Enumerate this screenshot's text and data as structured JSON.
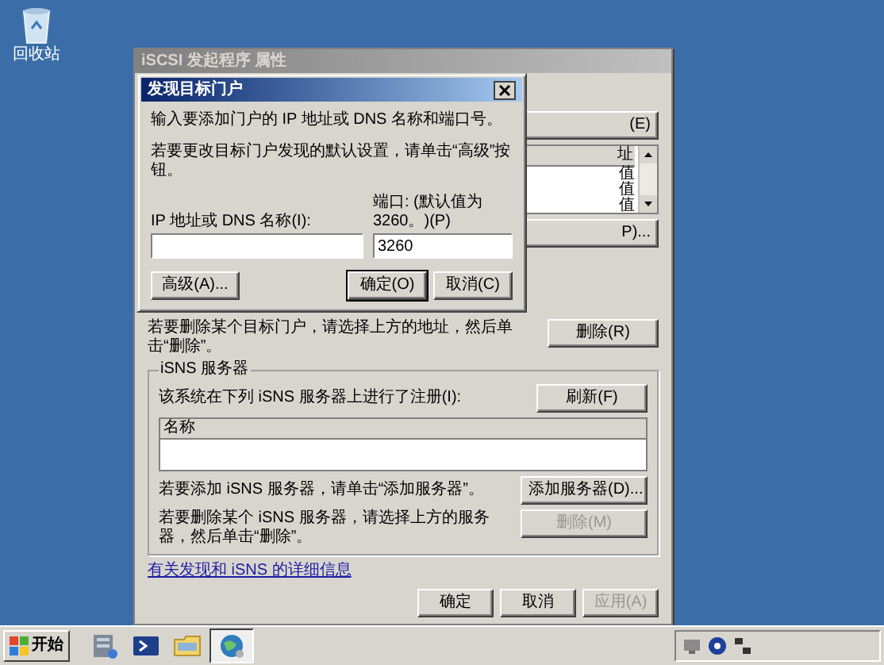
{
  "desktop_icons": [
    {
      "label": "回收站"
    }
  ],
  "parent_window": {
    "title": "iSCSI 发起程序 属性",
    "partial_button_1": "(E)",
    "partial_list": {
      "header": "址",
      "rows": [
        "值",
        "值",
        "值"
      ]
    },
    "partial_button_2": "P)...",
    "discovery_remove_text": "若要删除某个目标门户，请选择上方的地址，然后单击“删除”。",
    "remove_button": "删除(R)",
    "isns": {
      "group_title": "iSNS 服务器",
      "registered_label": "该系统在下列 iSNS 服务器上进行了注册(I):",
      "refresh_button": "刷新(F)",
      "list_header": "名称",
      "add_text": "若要添加 iSNS 服务器，请单击“添加服务器”。",
      "add_button": "添加服务器(D)...",
      "remove_text": "若要删除某个 iSNS 服务器，请选择上方的服务器，然后单击“删除”。",
      "remove_button": {
        "label": "删除(M)",
        "disabled": true
      }
    },
    "link": "有关发现和 iSNS 的详细信息",
    "buttons": [
      {
        "label": "确定",
        "disabled": false
      },
      {
        "label": "取消",
        "disabled": false
      },
      {
        "label": "应用(A)",
        "disabled": true
      }
    ]
  },
  "dialog": {
    "title": "发现目标门户",
    "intro": "输入要添加门户的 IP 地址或 DNS 名称和端口号。",
    "advanced_hint": "若要更改目标门户发现的默认设置，请单击“高级”按钮。",
    "address_label": "IP 地址或 DNS 名称(I):",
    "port_label": "端口: (默认值为 3260。)(P)",
    "port_value": "3260",
    "advanced_button": "高级(A)...",
    "buttons": [
      "确定(O)",
      "取消(C)"
    ]
  },
  "taskbar": {
    "start_label": "开始"
  }
}
